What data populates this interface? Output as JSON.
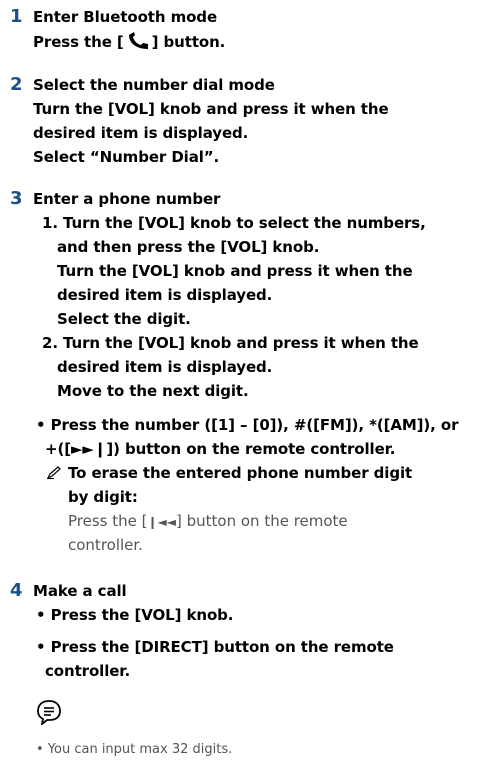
{
  "steps": [
    {
      "number": "1",
      "title": "Enter Bluetooth mode",
      "line_pre": "Press the [",
      "line_post": "] button."
    },
    {
      "number": "2",
      "title": "Select the number dial mode",
      "lines": [
        "Turn the [VOL] knob and press it when the",
        "desired item is displayed.",
        "Select “Number Dial”."
      ]
    },
    {
      "number": "3",
      "title": "Enter a phone number",
      "sub": [
        {
          "lines": [
            "1. Turn the [VOL] knob to select the numbers,",
            "and then press the [VOL] knob.",
            "Turn the [VOL] knob and press it when the",
            "desired item is displayed.",
            "Select the digit."
          ]
        },
        {
          "lines": [
            "2. Turn the [VOL] knob and press it when the",
            "desired item is displayed.",
            "Move to the next digit."
          ]
        }
      ],
      "bullet_lines": [
        "• Press the number ([1] – [0]), #([FM]), *([AM]), or",
        "+([►►❙]) button on the remote controller."
      ],
      "tip_title_lines": [
        "To erase the entered phone number digit",
        "by digit:"
      ],
      "tip_text_pre": "Press the [",
      "tip_text_glyph": "❙◄◄",
      "tip_text_post": "] button on the remote",
      "tip_text_line2": "controller."
    },
    {
      "number": "4",
      "title": "Make a call",
      "bullets": [
        "• Press the [VOL] knob.",
        "• Press the [DIRECT] button on the remote",
        "controller."
      ]
    }
  ],
  "note": "•  You can input max 32 digits.",
  "icons": {
    "phone": "phone-handset-icon",
    "pencil": "pencil-icon",
    "note": "note-speech-icon"
  },
  "colors": {
    "step_number": "#1a4f8b",
    "body_text": "#000000",
    "tip_text": "#555555"
  }
}
